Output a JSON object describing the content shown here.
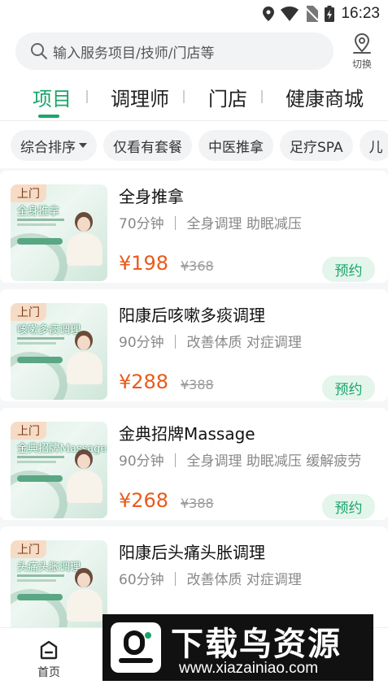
{
  "status_bar": {
    "time": "16:23",
    "icons": [
      "location-icon",
      "wifi-icon",
      "no-sim-icon",
      "battery-charging-icon"
    ]
  },
  "search": {
    "placeholder": "输入服务项目/技师/门店等",
    "switch_label": "切换",
    "switch_icon": "map-pin-icon"
  },
  "tabs": [
    {
      "label": "项目",
      "active": true
    },
    {
      "label": "调理师",
      "active": false
    },
    {
      "label": "门店",
      "active": false
    },
    {
      "label": "健康商城",
      "active": false
    }
  ],
  "filters": [
    {
      "label": "综合排序",
      "dropdown": true
    },
    {
      "label": "仅看有套餐"
    },
    {
      "label": "中医推拿"
    },
    {
      "label": "足疗SPA"
    },
    {
      "label": "儿"
    }
  ],
  "services": [
    {
      "badge": "上门",
      "title": "全身推拿",
      "desc": "70分钟 ｜ 全身调理 助眠减压",
      "price": "¥198",
      "original_price": "¥368",
      "button": "预约",
      "thumb_title": "全身推拿"
    },
    {
      "badge": "上门",
      "title": "阳康后咳嗽多痰调理",
      "desc": "90分钟 ｜ 改善体质 对症调理",
      "price": "¥288",
      "original_price": "¥388",
      "button": "预约",
      "thumb_title": "咳嗽多痰调理"
    },
    {
      "badge": "上门",
      "title": "金典招牌Massage",
      "desc": "90分钟 ｜ 全身调理 助眠减压 缓解疲劳",
      "price": "¥268",
      "original_price": "¥388",
      "button": "预约",
      "thumb_title": "金典招牌Massage"
    },
    {
      "badge": "上门",
      "title": "阳康后头痛头胀调理",
      "desc": "60分钟 ｜ 改善体质 对症调理",
      "price": "",
      "original_price": "",
      "button": "",
      "thumb_title": "头痛头胀调理"
    }
  ],
  "bottom_nav": {
    "home_label": "首页",
    "home_icon": "home-icon"
  },
  "watermark": {
    "title": "下载鸟资源",
    "url": "www.xiazainiao.com"
  },
  "colors": {
    "accent": "#1aa56a",
    "price": "#ea5a1a",
    "badge_bg": "#f6dcc6"
  }
}
